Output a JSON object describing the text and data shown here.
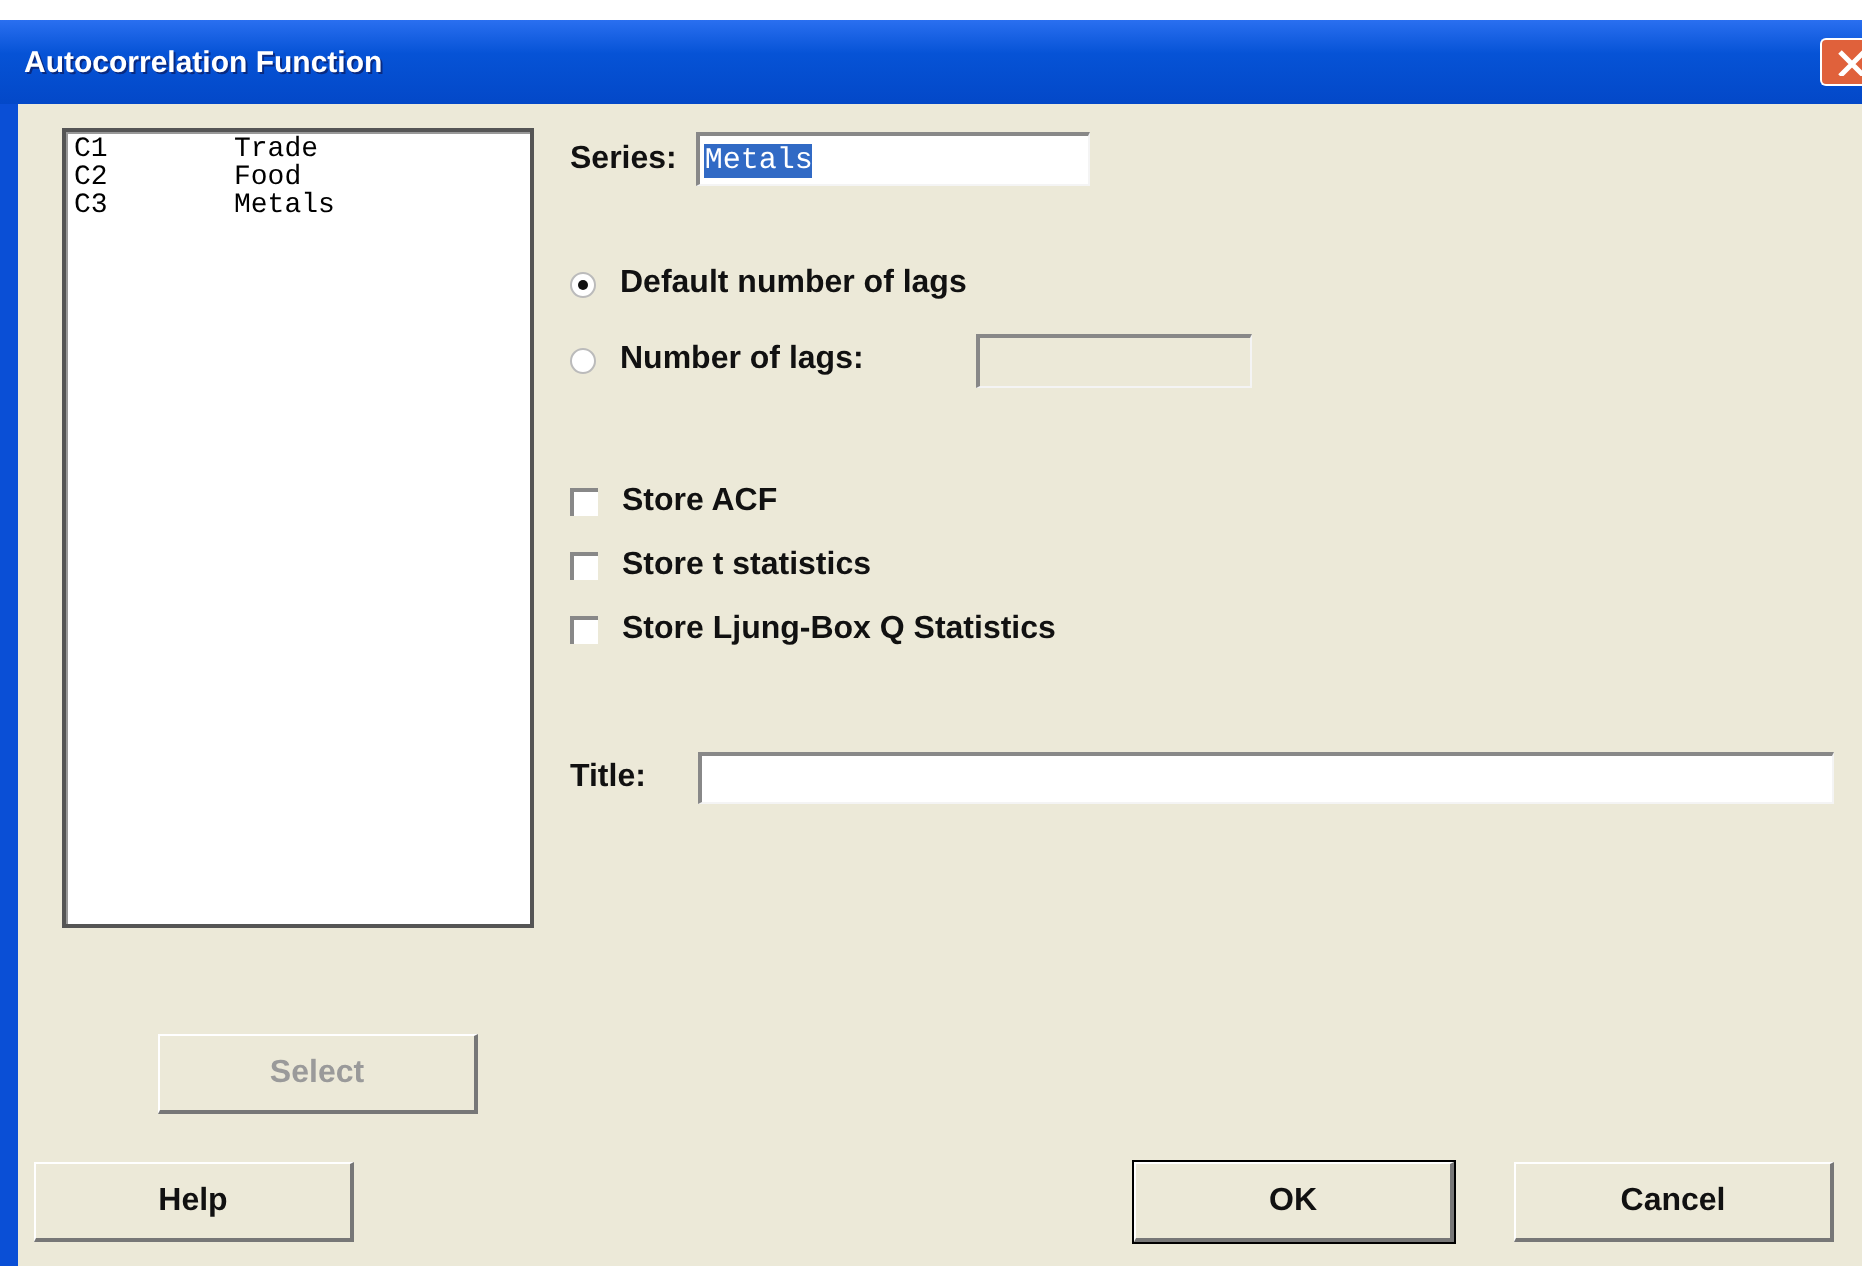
{
  "window": {
    "title": "Autocorrelation Function"
  },
  "variables": [
    {
      "column": "C1",
      "name": "Trade"
    },
    {
      "column": "C2",
      "name": "Food"
    },
    {
      "column": "C3",
      "name": "Metals"
    }
  ],
  "series": {
    "label": "Series:",
    "value": "Metals",
    "value_selected": true
  },
  "lag_options": [
    {
      "label": "Default number of lags",
      "selected": true,
      "kind": "plain"
    },
    {
      "label": "Number of lags:",
      "selected": false,
      "kind": "field"
    }
  ],
  "store_options": [
    {
      "label": "Store ACF",
      "checked": false
    },
    {
      "label": "Store t statistics",
      "checked": false
    },
    {
      "label": "Store Ljung-Box Q Statistics",
      "checked": false
    }
  ],
  "title_field": {
    "label": "Title:"
  },
  "select_button": {
    "label": "Select",
    "disabled": true
  },
  "buttons": [
    {
      "label": "Help",
      "kind": "help"
    },
    {
      "label": "OK",
      "kind": "default"
    },
    {
      "label": "Cancel",
      "kind": "cancel"
    }
  ]
}
